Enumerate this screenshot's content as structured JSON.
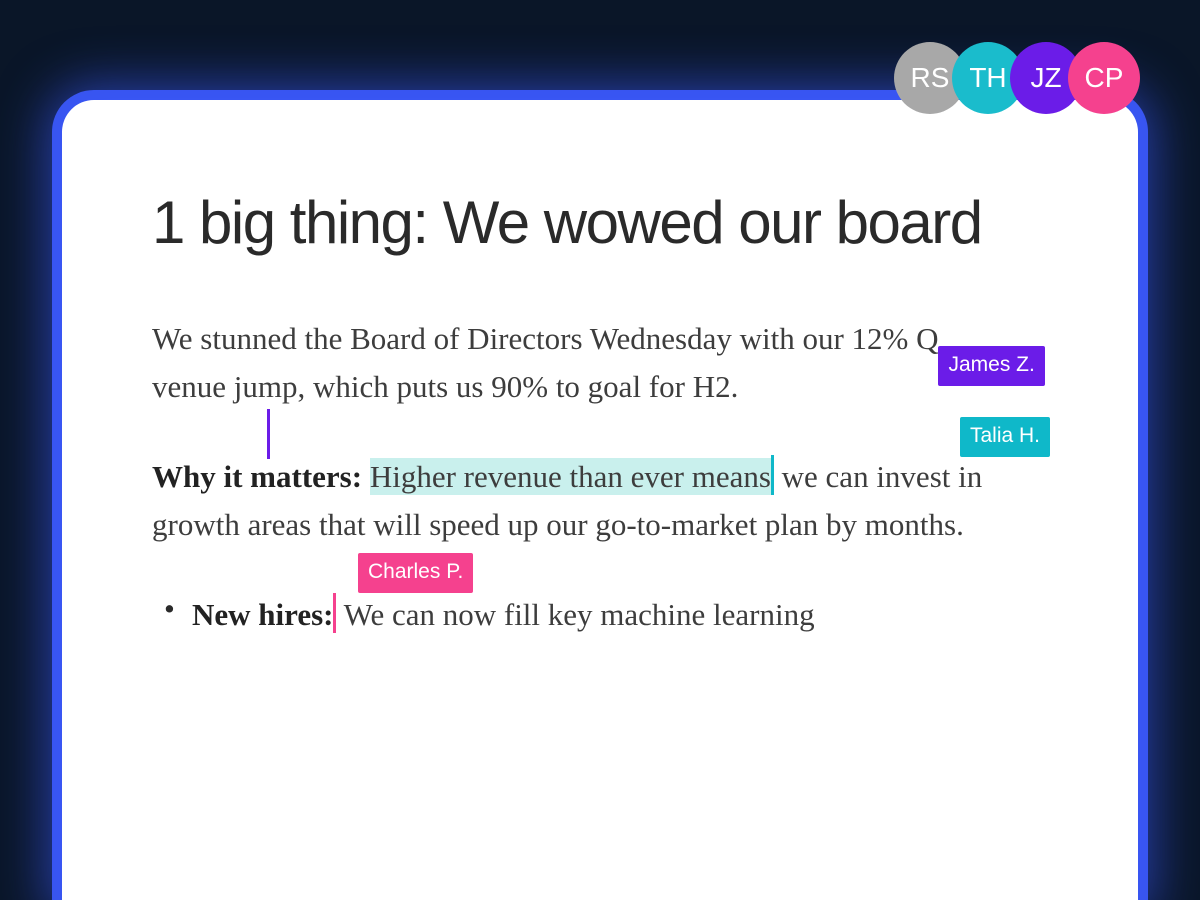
{
  "collaborators": [
    {
      "initials": "RS",
      "color": "grey"
    },
    {
      "initials": "TH",
      "color": "teal"
    },
    {
      "initials": "JZ",
      "color": "purple"
    },
    {
      "initials": "CP",
      "color": "pink"
    }
  ],
  "document": {
    "title": "1 big thing: We wowed our board",
    "paragraphs": {
      "p1_a": "We stunned the Board of Directors Wednesday with our 12% Q",
      "p1_b": "venue jump, which puts us 90% to goal for H2.",
      "p2_label": "Why it matters:",
      "p2_highlight": "Higher revenue than ever means",
      "p2_rest": " we can invest in growth areas that will speed up our go-to-market plan by months.",
      "bullet1_label": "New hires:",
      "bullet1_text": " We can now fill key machine learning"
    }
  },
  "cursors": {
    "james": "James Z.",
    "talia": "Talia H.",
    "charles": "Charles P."
  }
}
